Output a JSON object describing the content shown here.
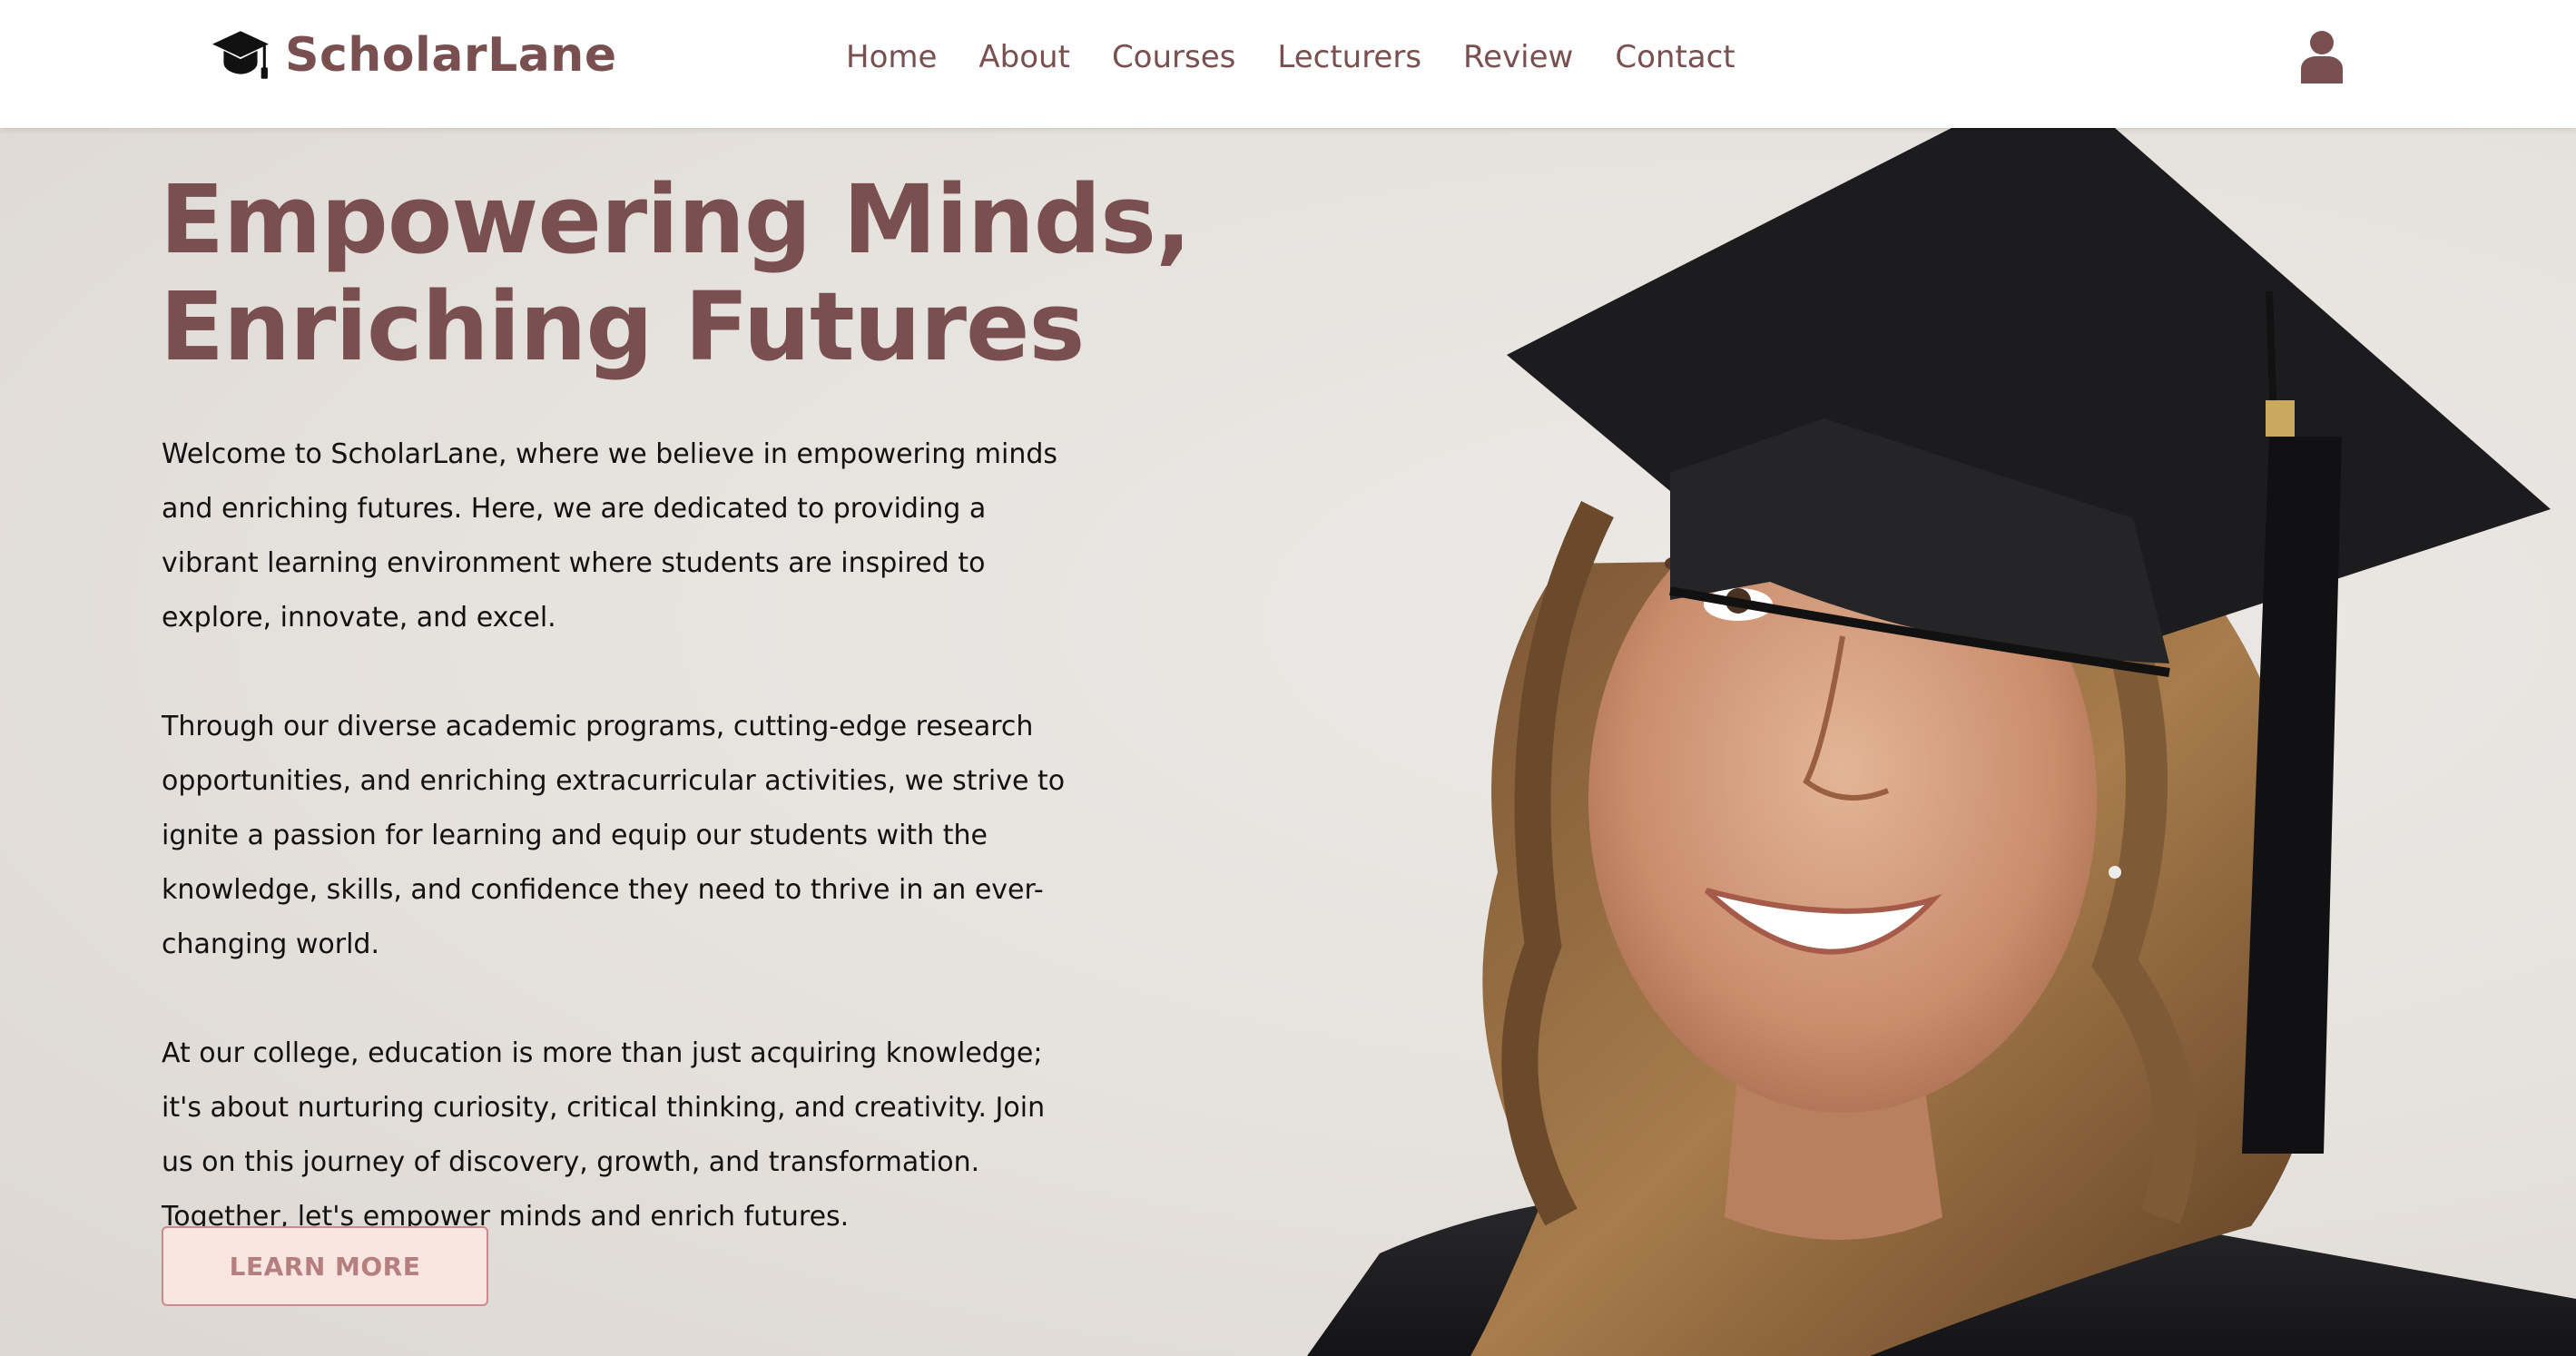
{
  "brand": {
    "name": "ScholarLane",
    "logo_icon": "graduation-cap-icon",
    "color": "#7a4f4f"
  },
  "nav": {
    "items": [
      {
        "label": "Home"
      },
      {
        "label": "About"
      },
      {
        "label": "Courses"
      },
      {
        "label": "Lecturers"
      },
      {
        "label": "Review"
      },
      {
        "label": "Contact"
      }
    ]
  },
  "header": {
    "user_icon": "user-icon"
  },
  "hero": {
    "title_line1": "Empowering Minds,",
    "title_line2": "Enriching Futures",
    "paragraphs": [
      "Welcome to ScholarLane, where we believe in empowering minds and enriching futures. Here, we are dedicated to providing a vibrant learning environment where students are inspired to explore, innovate, and excel.",
      "Through our diverse academic programs, cutting-edge research opportunities, and enriching extracurricular activities, we strive to ignite a passion for learning and equip our students with the knowledge, skills, and confidence they need to thrive in an ever-changing world.",
      "At our college, education is more than just acquiring knowledge; it's about nurturing curiosity, critical thinking, and creativity. Join us on this journey of discovery, growth, and transformation. Together, let's empower minds and enrich futures."
    ],
    "cta_label": "LEARN MORE",
    "image": "graduate-student-photo",
    "colors": {
      "accent": "#7a4f4f",
      "button_bg": "#f9e6e0",
      "button_border": "#c98b8b",
      "button_text": "#b57f7f"
    }
  }
}
